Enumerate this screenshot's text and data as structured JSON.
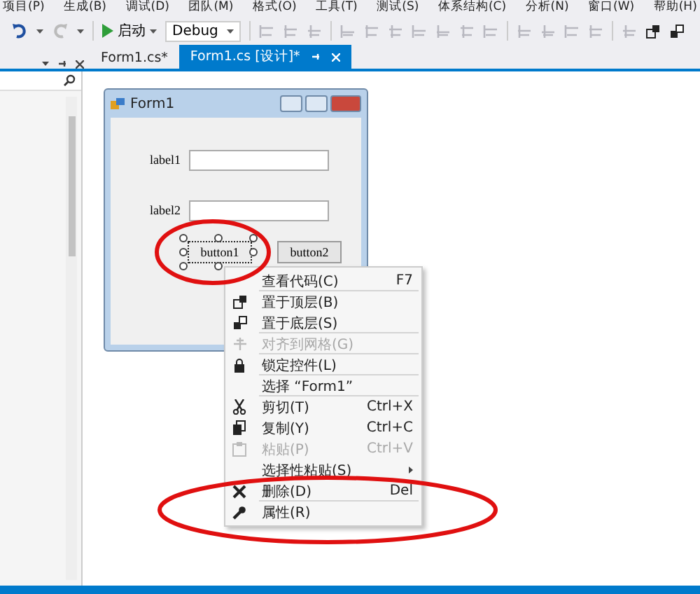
{
  "menu_bar": [
    "项目(P)",
    "生成(B)",
    "调试(D)",
    "团队(M)",
    "格式(O)",
    "工具(T)",
    "测试(S)",
    "体系结构(C)",
    "分析(N)",
    "窗口(W)",
    "帮助(H)"
  ],
  "toolbar": {
    "start": "启动",
    "configuration": "Debug"
  },
  "tabs": [
    {
      "label": "Form1.cs*",
      "selected": false
    },
    {
      "label": "Form1.cs [设计]*",
      "selected": true
    }
  ],
  "form": {
    "title": "Form1",
    "labels": [
      "label1",
      "label2"
    ],
    "buttons": [
      {
        "label": "button1",
        "selected": true
      },
      {
        "label": "button2",
        "selected": false
      }
    ]
  },
  "context_menu": [
    {
      "label": "查看代码(C)",
      "shortcut": "F7",
      "disabled": false,
      "separator_after": true
    },
    {
      "label": "置于顶层(B)",
      "disabled": false,
      "separator_after": false
    },
    {
      "label": "置于底层(S)",
      "disabled": false,
      "separator_after": true
    },
    {
      "label": "对齐到网格(G)",
      "disabled": true,
      "separator_after": true
    },
    {
      "label": "锁定控件(L)",
      "disabled": false,
      "separator_after": true
    },
    {
      "label": "选择 “Form1”",
      "disabled": false,
      "separator_after": true
    },
    {
      "label": "剪切(T)",
      "shortcut": "Ctrl+X",
      "disabled": false,
      "separator_after": false
    },
    {
      "label": "复制(Y)",
      "shortcut": "Ctrl+C",
      "disabled": false,
      "separator_after": false
    },
    {
      "label": "粘贴(P)",
      "shortcut": "Ctrl+V",
      "disabled": true,
      "separator_after": false
    },
    {
      "label": "选择性粘贴(S)",
      "submenu": true,
      "disabled": false,
      "separator_after": false
    },
    {
      "label": "删除(D)",
      "shortcut": "Del",
      "disabled": false,
      "separator_after": true
    },
    {
      "label": "属性(R)",
      "disabled": false,
      "separator_after": false
    }
  ]
}
